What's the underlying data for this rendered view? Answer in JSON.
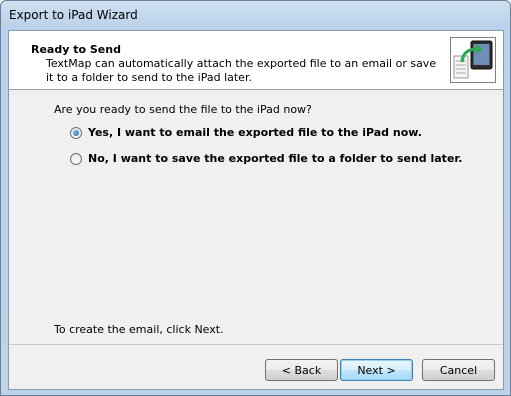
{
  "window": {
    "title": "Export to iPad Wizard"
  },
  "header": {
    "title": "Ready to Send",
    "description": "TextMap can automatically attach the exported file to an email or save it to a folder to send to the iPad later.",
    "graphic_icon": "ipad-export-icon"
  },
  "main": {
    "question": "Are you ready to send the file to the iPad now?",
    "options": [
      {
        "label": "Yes, I want to email the exported file to the iPad now.",
        "selected": true
      },
      {
        "label": "No, I want to save the exported file to a folder to send later.",
        "selected": false
      }
    ],
    "note": "To create the email, click Next."
  },
  "buttons": {
    "back": "< Back",
    "next": "Next >",
    "cancel": "Cancel"
  },
  "colors": {
    "accent": "#3c7fb1",
    "arrow": "#2fa84f"
  }
}
